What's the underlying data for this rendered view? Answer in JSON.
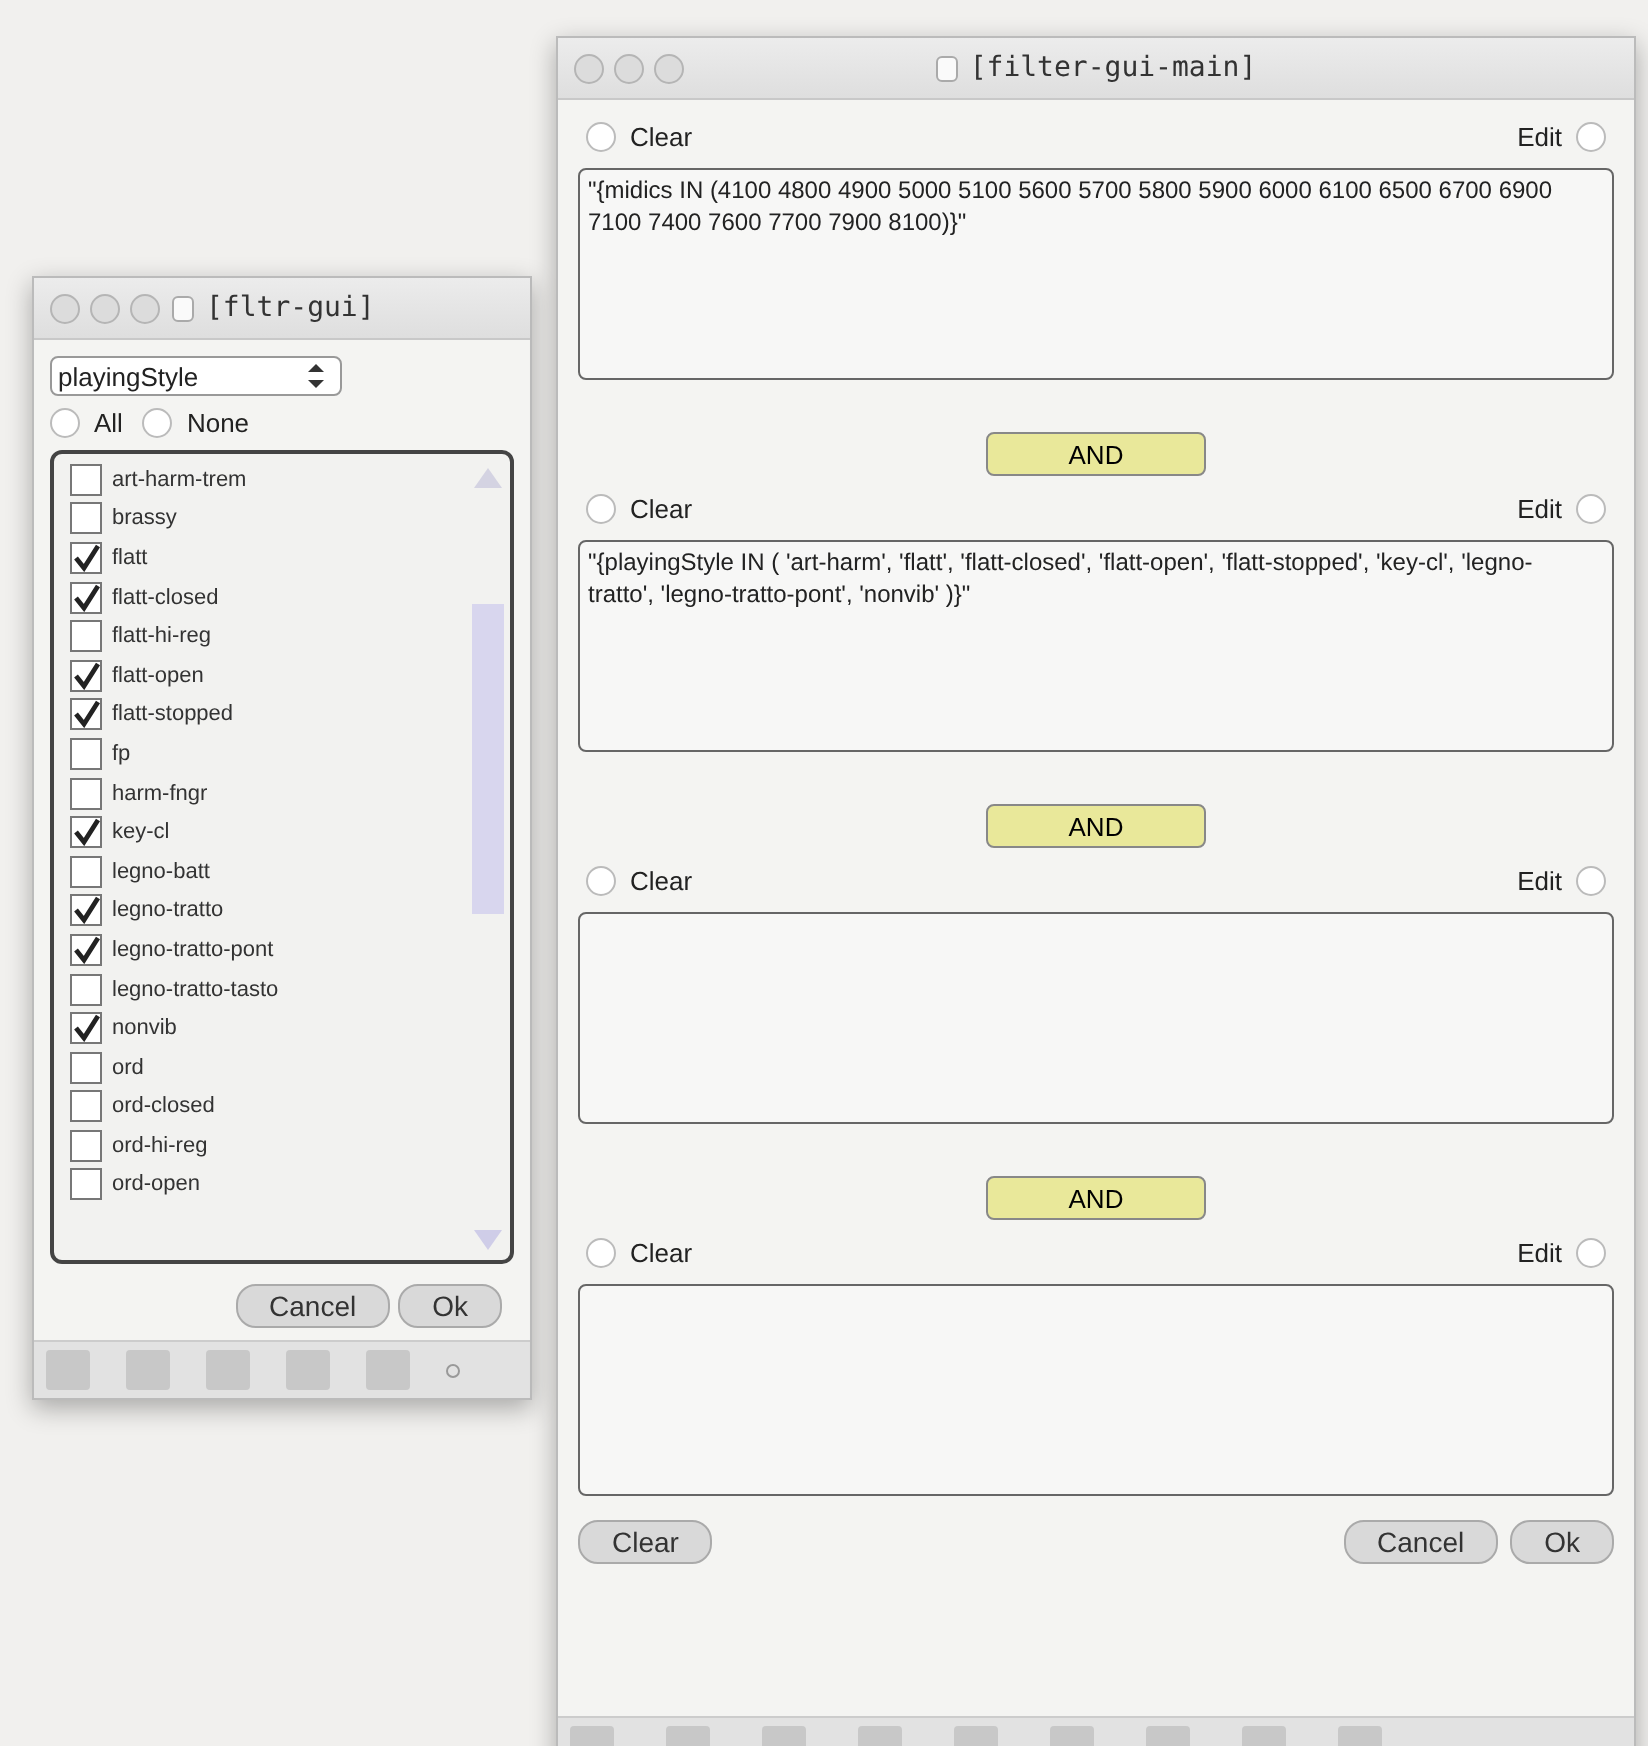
{
  "filter_window": {
    "title": "[fltr-gui]",
    "attribute_menu": {
      "value": "playingStyle"
    },
    "select_options": [
      {
        "label": "All",
        "selected": false
      },
      {
        "label": "None",
        "selected": false
      }
    ],
    "values": [
      {
        "label": "art-harm-trem",
        "checked": false
      },
      {
        "label": "brassy",
        "checked": false
      },
      {
        "label": "flatt",
        "checked": true
      },
      {
        "label": "flatt-closed",
        "checked": true
      },
      {
        "label": "flatt-hi-reg",
        "checked": false
      },
      {
        "label": "flatt-open",
        "checked": true
      },
      {
        "label": "flatt-stopped",
        "checked": true
      },
      {
        "label": "fp",
        "checked": false
      },
      {
        "label": "harm-fngr",
        "checked": false
      },
      {
        "label": "key-cl",
        "checked": true
      },
      {
        "label": "legno-batt",
        "checked": false
      },
      {
        "label": "legno-tratto",
        "checked": true
      },
      {
        "label": "legno-tratto-pont",
        "checked": true
      },
      {
        "label": "legno-tratto-tasto",
        "checked": false
      },
      {
        "label": "nonvib",
        "checked": true
      },
      {
        "label": "ord",
        "checked": false
      },
      {
        "label": "ord-closed",
        "checked": false
      },
      {
        "label": "ord-hi-reg",
        "checked": false
      },
      {
        "label": "ord-open",
        "checked": false
      }
    ],
    "buttons": [
      "Cancel",
      "Ok"
    ]
  },
  "main_window": {
    "title": "[filter-gui-main]",
    "clauses": [
      {
        "clear_label": "Clear",
        "clear_selected": false,
        "edit_label": "Edit",
        "edit_selected": false,
        "text": "\"{midics IN (4100 4800 4900 5000 5100 5600 5700 5800 5900 6000 6100 6500 6700 6900 7100 7400 7600 7700 7900 8100)}\""
      },
      {
        "clear_label": "Clear",
        "clear_selected": false,
        "edit_label": "Edit",
        "edit_selected": false,
        "text": "\"{playingStyle IN ( 'art-harm', 'flatt', 'flatt-closed', 'flatt-open', 'flatt-stopped', 'key-cl', 'legno-tratto', 'legno-tratto-pont', 'nonvib' )}\""
      },
      {
        "clear_label": "Clear",
        "clear_selected": false,
        "edit_label": "Edit",
        "edit_selected": false
      },
      {
        "clear_label": "Clear",
        "clear_selected": false,
        "edit_label": "Edit",
        "edit_selected": false
      }
    ],
    "operators": [
      "AND",
      "AND",
      "AND"
    ],
    "buttons_left": [
      "Clear"
    ],
    "buttons_right": [
      "Cancel",
      "Ok"
    ]
  }
}
